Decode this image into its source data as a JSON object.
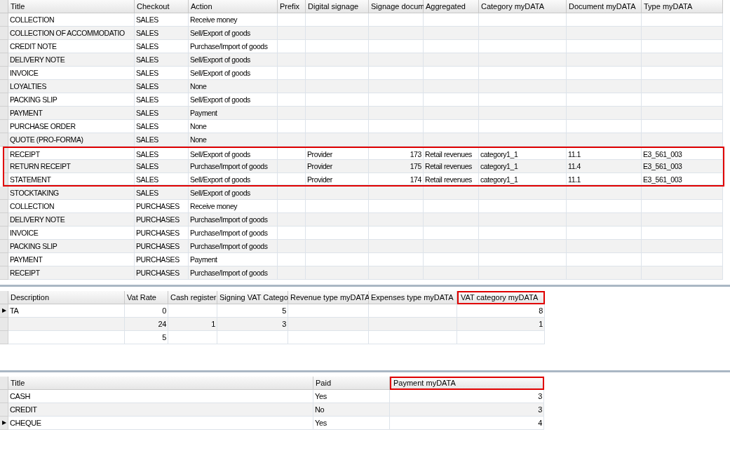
{
  "document_types": {
    "columns": [
      {
        "label": "Title",
        "highlighted": false
      },
      {
        "label": "Checkout",
        "highlighted": false
      },
      {
        "label": "Action",
        "highlighted": false
      },
      {
        "label": "Prefix",
        "highlighted": false
      },
      {
        "label": "Digital signage",
        "highlighted": false
      },
      {
        "label": "Signage docum",
        "highlighted": false
      },
      {
        "label": "Aggregated",
        "highlighted": false
      },
      {
        "label": "Category myDATA",
        "highlighted": false
      },
      {
        "label": "Document myDATA",
        "highlighted": false
      },
      {
        "label": "Type myDATA",
        "highlighted": false
      }
    ],
    "rows": [
      {
        "cells": [
          "COLLECTION",
          "SALES",
          "Receive money",
          "",
          "",
          "",
          "",
          "",
          "",
          ""
        ],
        "highlighted": false,
        "current": false
      },
      {
        "cells": [
          "COLLECTION OF ACCOMMODATIO",
          "SALES",
          "Sell/Export of goods",
          "",
          "",
          "",
          "",
          "",
          "",
          ""
        ],
        "highlighted": false,
        "current": false
      },
      {
        "cells": [
          "CREDIT NOTE",
          "SALES",
          "Purchase/Import of goods",
          "",
          "",
          "",
          "",
          "",
          "",
          ""
        ],
        "highlighted": false,
        "current": false
      },
      {
        "cells": [
          "DELIVERY NOTE",
          "SALES",
          "Sell/Export of goods",
          "",
          "",
          "",
          "",
          "",
          "",
          ""
        ],
        "highlighted": false,
        "current": false
      },
      {
        "cells": [
          "INVOICE",
          "SALES",
          "Sell/Export of goods",
          "",
          "",
          "",
          "",
          "",
          "",
          ""
        ],
        "highlighted": false,
        "current": false
      },
      {
        "cells": [
          "LOYALTIES",
          "SALES",
          "None",
          "",
          "",
          "",
          "",
          "",
          "",
          ""
        ],
        "highlighted": false,
        "current": false
      },
      {
        "cells": [
          "PACKING SLIP",
          "SALES",
          "Sell/Export of goods",
          "",
          "",
          "",
          "",
          "",
          "",
          ""
        ],
        "highlighted": false,
        "current": false
      },
      {
        "cells": [
          "PAYMENT",
          "SALES",
          "Payment",
          "",
          "",
          "",
          "",
          "",
          "",
          ""
        ],
        "highlighted": false,
        "current": false
      },
      {
        "cells": [
          "PURCHASE ORDER",
          "SALES",
          "None",
          "",
          "",
          "",
          "",
          "",
          "",
          ""
        ],
        "highlighted": false,
        "current": false
      },
      {
        "cells": [
          "QUOTE (PRO-FORMA)",
          "SALES",
          "None",
          "",
          "",
          "",
          "",
          "",
          "",
          ""
        ],
        "highlighted": false,
        "current": false
      },
      {
        "cells": [
          "RECEIPT",
          "SALES",
          "Sell/Export of goods",
          "",
          "Provider",
          "173",
          "Retail revenues",
          "category1_1",
          "11.1",
          "E3_561_003"
        ],
        "highlighted": true,
        "current": false
      },
      {
        "cells": [
          "RETURN RECEIPT",
          "SALES",
          "Purchase/Import of goods",
          "",
          "Provider",
          "175",
          "Retail revenues",
          "category1_1",
          "11.4",
          "E3_561_003"
        ],
        "highlighted": true,
        "current": false
      },
      {
        "cells": [
          "STATEMENT",
          "SALES",
          "Sell/Export of goods",
          "",
          "Provider",
          "174",
          "Retail revenues",
          "category1_1",
          "11.1",
          "E3_561_003"
        ],
        "highlighted": true,
        "current": false
      },
      {
        "cells": [
          "STOCKTAKING",
          "SALES",
          "Sell/Export of goods",
          "",
          "",
          "",
          "",
          "",
          "",
          ""
        ],
        "highlighted": false,
        "current": false
      },
      {
        "cells": [
          "COLLECTION",
          "PURCHASES",
          "Receive money",
          "",
          "",
          "",
          "",
          "",
          "",
          ""
        ],
        "highlighted": false,
        "current": false
      },
      {
        "cells": [
          "DELIVERY NOTE",
          "PURCHASES",
          "Purchase/Import of goods",
          "",
          "",
          "",
          "",
          "",
          "",
          ""
        ],
        "highlighted": false,
        "current": false
      },
      {
        "cells": [
          "INVOICE",
          "PURCHASES",
          "Purchase/Import of goods",
          "",
          "",
          "",
          "",
          "",
          "",
          ""
        ],
        "highlighted": false,
        "current": false
      },
      {
        "cells": [
          "PACKING SLIP",
          "PURCHASES",
          "Purchase/Import of goods",
          "",
          "",
          "",
          "",
          "",
          "",
          ""
        ],
        "highlighted": false,
        "current": false
      },
      {
        "cells": [
          "PAYMENT",
          "PURCHASES",
          "Payment",
          "",
          "",
          "",
          "",
          "",
          "",
          ""
        ],
        "highlighted": false,
        "current": false
      },
      {
        "cells": [
          "RECEIPT",
          "PURCHASES",
          "Purchase/Import of goods",
          "",
          "",
          "",
          "",
          "",
          "",
          ""
        ],
        "highlighted": false,
        "current": false
      }
    ]
  },
  "vat_rates": {
    "columns": [
      {
        "label": "Description",
        "highlighted": false
      },
      {
        "label": "Vat Rate",
        "highlighted": false
      },
      {
        "label": "Cash register",
        "highlighted": false
      },
      {
        "label": "Signing VAT Catego",
        "highlighted": false
      },
      {
        "label": "Revenue type myDATA",
        "highlighted": false
      },
      {
        "label": "Expenses type myDATA",
        "highlighted": false
      },
      {
        "label": "VAT category myDATA",
        "highlighted": true
      }
    ],
    "rows": [
      {
        "cells": [
          "TA",
          "0",
          "",
          "5",
          "",
          "",
          "8"
        ],
        "highlighted": false,
        "current": true
      },
      {
        "cells": [
          "",
          "24",
          "1",
          "3",
          "",
          "",
          "1"
        ],
        "highlighted": false,
        "current": false
      },
      {
        "cells": [
          "",
          "5",
          "",
          "",
          "",
          "",
          ""
        ],
        "highlighted": false,
        "current": false
      }
    ]
  },
  "payment_methods": {
    "columns": [
      {
        "label": "Title",
        "highlighted": false
      },
      {
        "label": "Paid",
        "highlighted": false
      },
      {
        "label": "Payment myDATA",
        "highlighted": true
      }
    ],
    "rows": [
      {
        "cells": [
          "CASH",
          "Yes",
          "3"
        ],
        "highlighted": false,
        "current": false
      },
      {
        "cells": [
          "CREDIT",
          "No",
          "3"
        ],
        "highlighted": false,
        "current": false
      },
      {
        "cells": [
          "CHEQUE",
          "Yes",
          "4"
        ],
        "highlighted": false,
        "current": true
      }
    ]
  },
  "current_row_marker": "▶"
}
